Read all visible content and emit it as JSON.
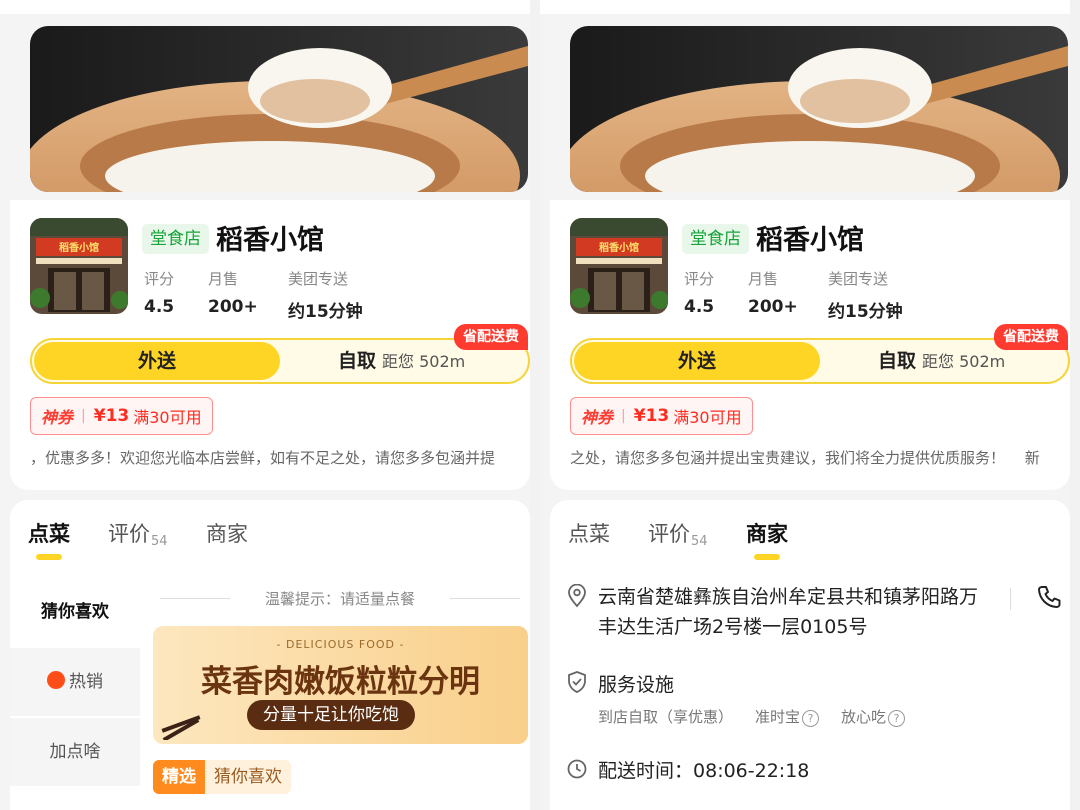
{
  "store": {
    "tag": "堂食店",
    "name": "稻香小馆",
    "stats": [
      {
        "label": "评分",
        "value": "4.5"
      },
      {
        "label": "月售",
        "value": "200+"
      },
      {
        "label": "美团专送",
        "value": "约15分钟"
      }
    ],
    "sign_text": "稻香小馆"
  },
  "delivery_toggle": {
    "delivery": "外送",
    "pickup": "自取",
    "distance": "距您 502m",
    "badge": "省配送费"
  },
  "coupon": {
    "brand": "神券",
    "separator": "|",
    "amount": "¥13",
    "condition": "满30可用"
  },
  "marquee": {
    "left_text": "，优惠多多！欢迎您光临本店尝鲜，如有不足之处，请您多多包涵并提",
    "right_text": "之处，请您多多包涵并提出宝贵建议，我们将全力提供优质服务！　 新"
  },
  "tabs": [
    {
      "label": "点菜"
    },
    {
      "label": "评价",
      "count": "54"
    },
    {
      "label": "商家"
    }
  ],
  "menu": {
    "categories": [
      {
        "label": "猜你喜欢"
      },
      {
        "label": "热销"
      },
      {
        "label": "加点啥"
      }
    ],
    "tip": "温馨提示：请适量点餐",
    "banner": {
      "small": "- DELICIOUS FOOD -",
      "title": "菜香肉嫩饭粒粒分明",
      "pill": "分量十足让你吃饱"
    },
    "section_tag": "精选",
    "section_title": "猜你喜欢"
  },
  "merchant": {
    "address": "云南省楚雄彝族自治州牟定县共和镇茅阳路万丰达生活广场2号楼一层0105号",
    "services_title": "服务设施",
    "services": [
      "到店自取（享优惠）",
      "准时宝",
      "放心吃"
    ],
    "hours_label": "配送时间：",
    "hours": "08:06-22:18"
  },
  "colors": {
    "accent": "#ffd525",
    "red": "#ff3b30",
    "green": "#17a33a"
  },
  "icons": [
    "location-pin-icon",
    "phone-icon",
    "shield-check-icon",
    "clock-icon",
    "help-circle-icon",
    "flame-icon"
  ]
}
